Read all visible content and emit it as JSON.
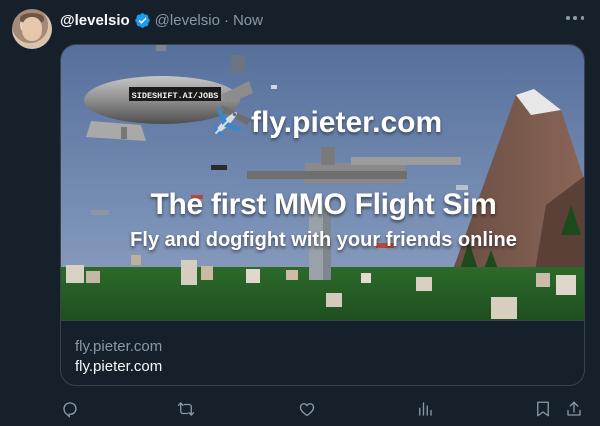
{
  "tweet": {
    "display_name": "@levelsio",
    "handle": "@levelsio",
    "separator": "·",
    "timestamp": "Now"
  },
  "card": {
    "brand_text": "fly.pieter.com",
    "headline": "The first MMO Flight Sim",
    "subheadline": "Fly and dogfight with your friends online",
    "blimp_text": "SIDESHIFT.AI/JOBS",
    "domain": "fly.pieter.com",
    "title": "fly.pieter.com"
  },
  "icons": {
    "more": "more-icon",
    "verified": "verified-badge-icon",
    "reply": "reply-icon",
    "retweet": "retweet-icon",
    "like": "like-icon",
    "views": "views-icon",
    "bookmark": "bookmark-icon",
    "share": "share-icon"
  },
  "colors": {
    "background": "#15202b",
    "text_primary": "#f7f9f9",
    "text_secondary": "#8b98a5",
    "border": "#38444d",
    "verified": "#1d9bf0"
  }
}
